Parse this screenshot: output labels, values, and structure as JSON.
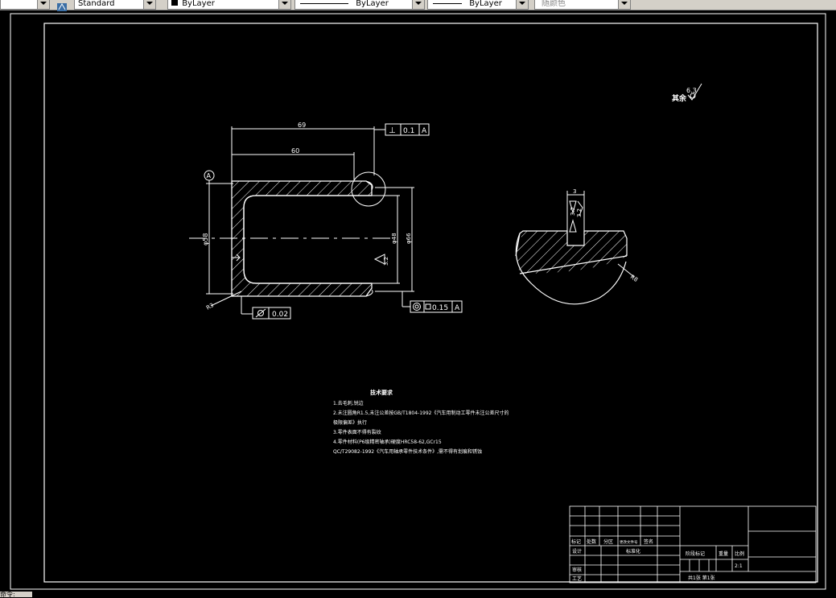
{
  "toolbar": {
    "textstyle": "Standard",
    "layer_color": "ByLayer",
    "linetype": "ByLayer",
    "lineweight": "ByLayer",
    "plotstyle": "随颜色"
  },
  "drawing": {
    "surface_note_text": "其余",
    "surface_note_value": "6.3",
    "dim_overall": "69",
    "dim_inner": "60",
    "gdt_perp_symbol": "⊥",
    "gdt_perp_value": "0.1",
    "gdt_perp_datum": "A",
    "datum_label": "A",
    "dim_phi_left": "φ58",
    "dim_phi_inner": "φ48",
    "dim_phi_outer": "φ66",
    "rough_inner": "3.2",
    "radius_left": "R3",
    "gdt_cyl_value": "0.02",
    "gdt_conc_value1": "0.15",
    "gdt_conc_datum": "A",
    "rough_right1": "3.2",
    "rough_right2": "3.2",
    "dim_right_top": "3",
    "radius_right": "R8"
  },
  "notes": {
    "title": "技术要求",
    "lines": [
      "1.去毛刺,锐边",
      "2.未注圆角R1.5,未注公差按GB/T1804-1992《汽车用制动工零件未注公差尺寸的",
      "极限偏差》执行",
      "3.零件表面不得有裂纹",
      "4.零件材料(P6级精密轴承)硬度HRC58-62,GCr15",
      "QC/T29082-1992《汽车用轴承零件技术条件》,需不得有划痕和锈蚀"
    ]
  },
  "title_block": {
    "col_labels": [
      "标记",
      "处数",
      "分区",
      "更改文件号",
      "签名",
      "年月日"
    ],
    "design": "设计",
    "standard": "标准化",
    "stage": "阶段标记",
    "weight": "重量",
    "scale_label": "比例",
    "scale_value": "2:1",
    "review": "审核",
    "process": "工艺",
    "sheets": "共1张  第1张"
  },
  "status": {
    "text": "命令:"
  }
}
